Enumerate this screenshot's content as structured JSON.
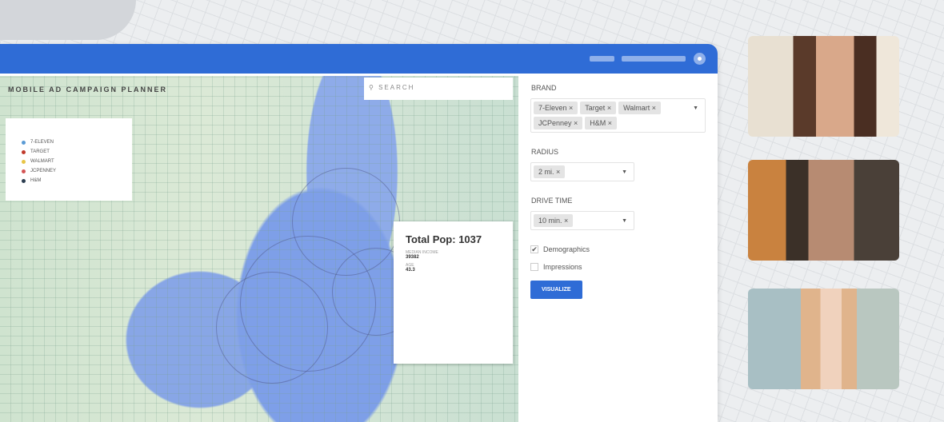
{
  "app": {
    "title": "MOBILE AD CAMPAIGN PLANNER",
    "search_placeholder": "SEARCH"
  },
  "legend": [
    {
      "label": "7-ELEVEN",
      "color": "#5b9bd5"
    },
    {
      "label": "TARGET",
      "color": "#c0392b"
    },
    {
      "label": "WALMART",
      "color": "#e8c547"
    },
    {
      "label": "JCPENNEY",
      "color": "#d35454"
    },
    {
      "label": "H&M",
      "color": "#2c3e50"
    }
  ],
  "popup": {
    "title": "Total Pop: 1037",
    "income_label": "MEDIAN INCOME",
    "income_value": "39382",
    "age_label": "AGE",
    "age_value": "43.3"
  },
  "panel": {
    "brand_label": "BRAND",
    "brands": [
      "7-Eleven",
      "Target",
      "Walmart",
      "JCPenney",
      "H&M"
    ],
    "radius_label": "RADIUS",
    "radius": "2 mi.",
    "drive_label": "DRIVE TIME",
    "drive": "10 min.",
    "demographics": "Demographics",
    "demographics_checked": true,
    "impressions": "Impressions",
    "impressions_checked": false,
    "visualize": "VISUALIZE"
  },
  "colors": {
    "accent": "#2f6cd6"
  }
}
